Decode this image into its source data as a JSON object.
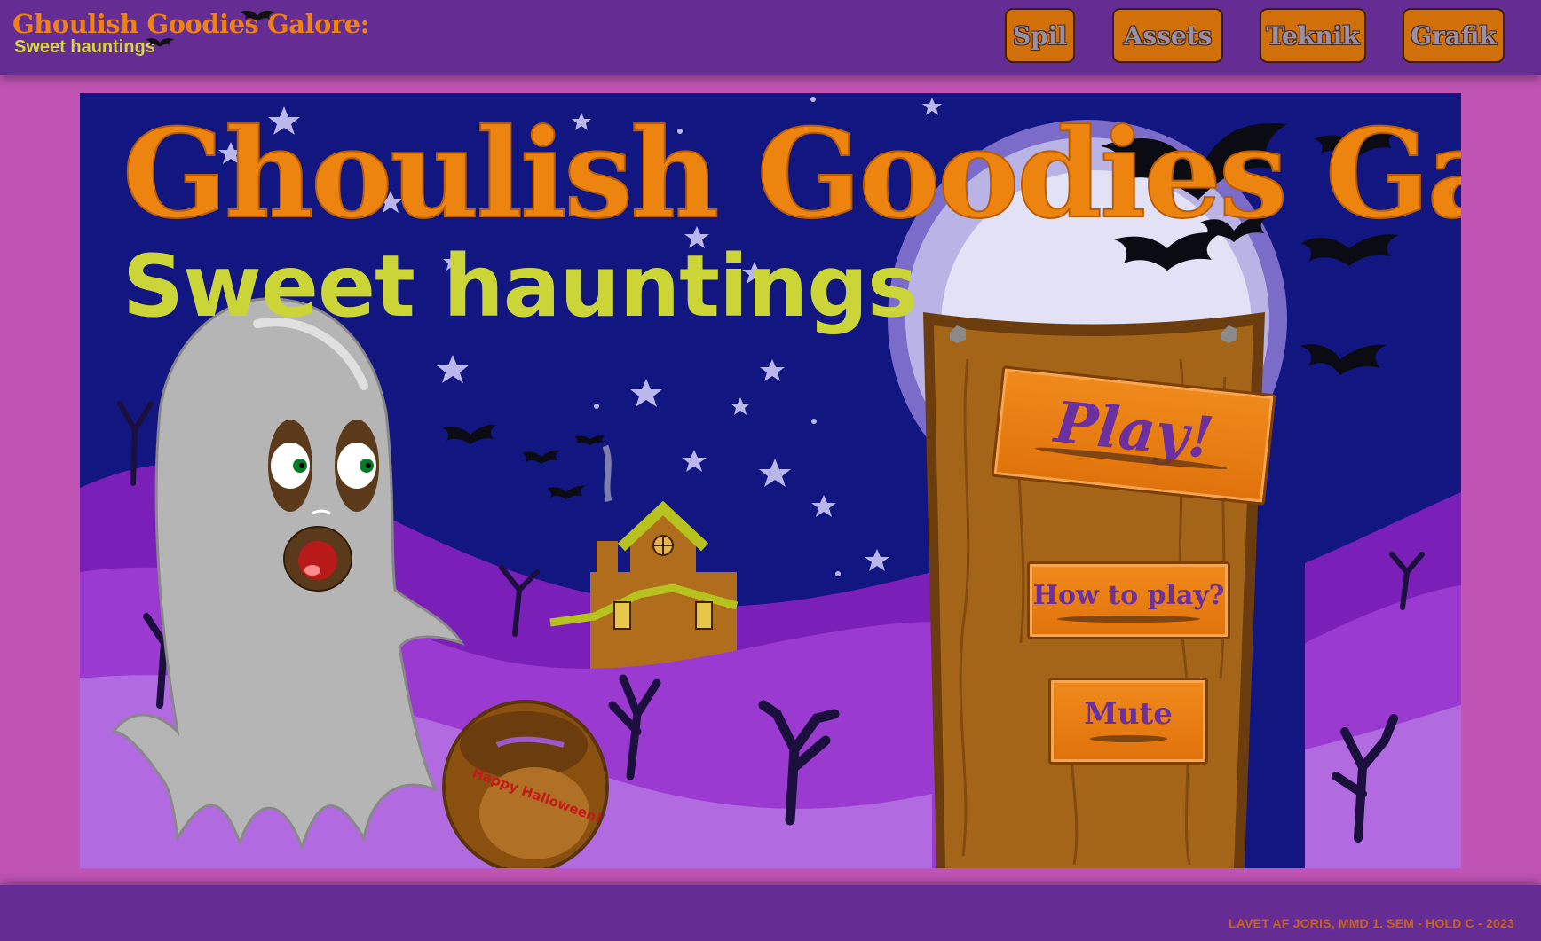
{
  "header": {
    "logo_title": "Ghoulish Goodies Galore:",
    "logo_subtitle": "Sweet hauntings",
    "nav": [
      {
        "label": "Spil"
      },
      {
        "label": "Assets"
      },
      {
        "label": "Teknik"
      },
      {
        "label": "Grafik"
      }
    ]
  },
  "game": {
    "title": "Ghoulish Goodies Galore:",
    "subtitle": "Sweet hauntings",
    "menu": {
      "play_label": "Play!",
      "how_to_label": "How to play?",
      "mute_label": "Mute"
    },
    "bucket_text": "Happy Halloween!"
  },
  "footer": {
    "credit": "Lavet af Joris, MMD 1. sem - Hold C - 2023"
  },
  "colors": {
    "header_bg": "#652d94",
    "page_bg": "#c054b4",
    "accent_orange": "#ee8410",
    "subtitle_yellow": "#ccd537",
    "sky": "#121680",
    "hills": "#8a2dc4"
  }
}
